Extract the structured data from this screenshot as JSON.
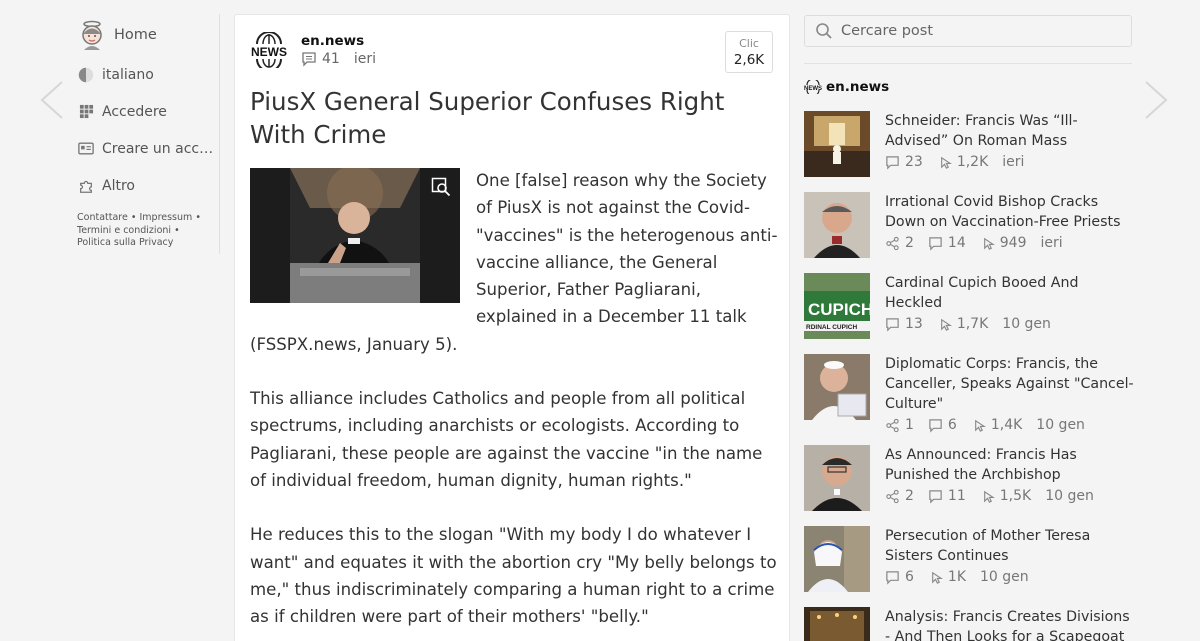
{
  "sidebar": {
    "items": [
      {
        "label": "Home",
        "icon": "mascot-icon"
      },
      {
        "label": "italiano",
        "icon": "half-circle-icon"
      },
      {
        "label": "Accedere",
        "icon": "grid-icon"
      },
      {
        "label": "Creare un account",
        "icon": "id-card-icon"
      },
      {
        "label": "Altro",
        "icon": "puzzle-icon"
      }
    ],
    "footer": {
      "contact": "Contattare",
      "impressum": "Impressum",
      "terms": "Termini e condizioni",
      "privacy": "Politica sulla Privacy"
    }
  },
  "post": {
    "source": "en.news",
    "comments": "41",
    "date": "ieri",
    "clicks_label": "Clic",
    "clicks_value": "2,6K",
    "title": "PiusX General Superior Confuses Right With Crime",
    "paragraphs": [
      "One [false] reason why the Society of PiusX is not against the Covid-\"vaccines\" is the heteroge­nous anti-vaccine alliance, the General Superior, Father Pagliarani, explained in a December 11 talk (FSSPX.news, January 5).",
      "This alliance includes Catholics and people from all political spectrums, including anarchists or ecologists. According to Pagliarani, these people are against the vaccine \"in the name of individual freedom, human dignity, human rights.\"",
      "He reduces this to the slogan \"With my body I do whatever I want\" and equates it with the abortion cry \"My belly belongs to me,\" thus indiscriminately comparing a human right to a crime as if children were part of their mothers' \"belly.\""
    ]
  },
  "search": {
    "placeholder": "Cercare post"
  },
  "related": {
    "source": "en.news",
    "items": [
      {
        "title": "Schneider: Francis Was “Ill-Advised” On Roman Mass",
        "shares": "",
        "comments": "23",
        "clicks": "1,2K",
        "date": "ieri"
      },
      {
        "title": "Irrational Covid Bishop Cracks Down on Vaccination-Free Priests",
        "shares": "2",
        "comments": "14",
        "clicks": "949",
        "date": "ieri"
      },
      {
        "title": "Cardinal Cupich Booed And Heckled",
        "shares": "",
        "comments": "13",
        "clicks": "1,7K",
        "date": "10 gen"
      },
      {
        "title": "Diplomatic Corps: Francis, the Canceller, Speaks Against \"Cancel-Culture\"",
        "shares": "1",
        "comments": "6",
        "clicks": "1,4K",
        "date": "10 gen"
      },
      {
        "title": "As Announced: Francis Has Punished the Archbishop",
        "shares": "2",
        "comments": "11",
        "clicks": "1,5K",
        "date": "10 gen"
      },
      {
        "title": "Persecution of Mother Teresa Sisters Continues",
        "shares": "",
        "comments": "6",
        "clicks": "1K",
        "date": "10 gen"
      },
      {
        "title": "Analysis: Francis Creates Divisions - And Then Looks for a Scapegoat to",
        "shares": "",
        "comments": "",
        "clicks": "",
        "date": ""
      }
    ]
  },
  "colors": {
    "background": "#f4f4f4",
    "card": "#ffffff",
    "text": "#333333",
    "meta": "#777777"
  }
}
